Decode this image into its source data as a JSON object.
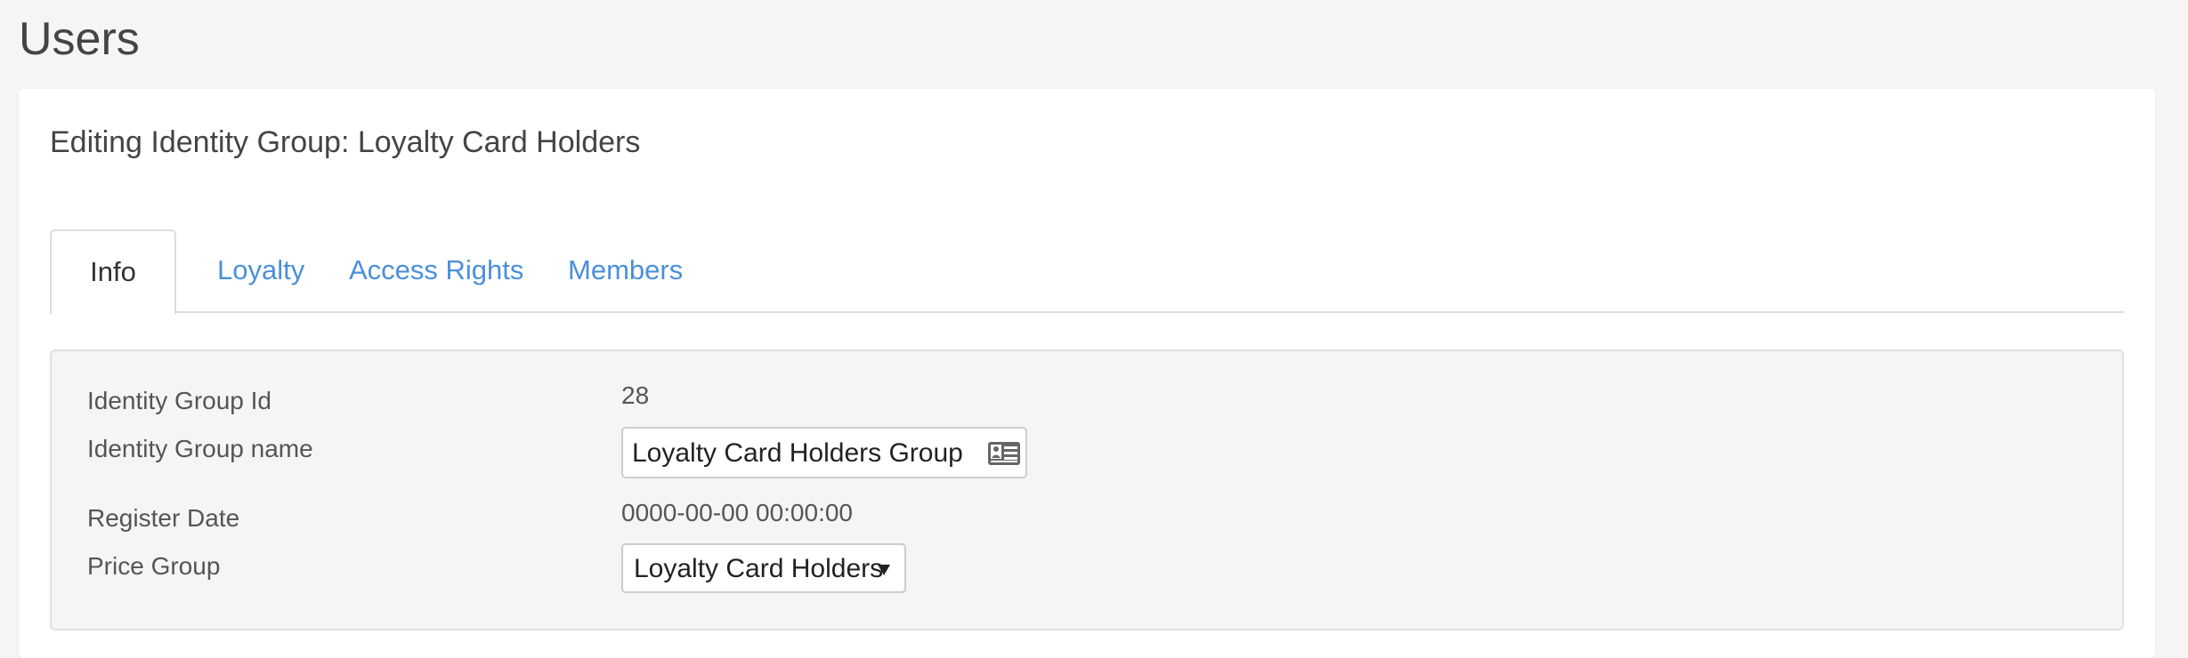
{
  "page": {
    "title": "Users"
  },
  "panel": {
    "heading": "Editing Identity Group: Loyalty Card Holders"
  },
  "tabs": [
    {
      "label": "Info",
      "active": true
    },
    {
      "label": "Loyalty",
      "active": false
    },
    {
      "label": "Access Rights",
      "active": false
    },
    {
      "label": "Members",
      "active": false
    }
  ],
  "form": {
    "group_id": {
      "label": "Identity Group Id",
      "value": "28"
    },
    "group_name": {
      "label": "Identity Group name",
      "value": "Loyalty Card Holders Group",
      "icon": "id-card-icon"
    },
    "register_date": {
      "label": "Register Date",
      "value": "0000-00-00 00:00:00"
    },
    "price_group": {
      "label": "Price Group",
      "selected": "Loyalty Card Holders",
      "icon": "caret-down-icon"
    }
  },
  "colors": {
    "link": "#4a90d9",
    "page_background": "#f5f5f5",
    "panel_background": "#ffffff",
    "info_background": "#f5f5f5",
    "border": "#dddddd"
  }
}
